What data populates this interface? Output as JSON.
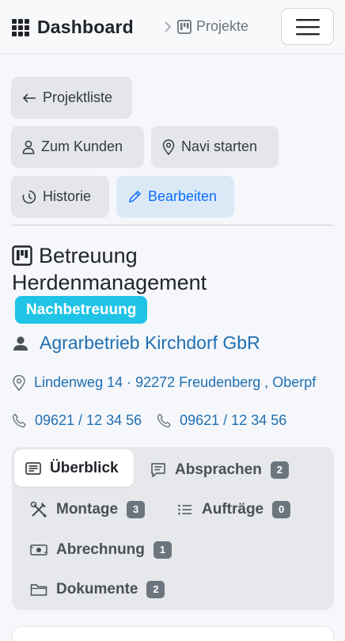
{
  "header": {
    "brand": "Dashboard",
    "breadcrumb": "Projekte"
  },
  "actions": {
    "back": "Projektliste",
    "customer": "Zum Kunden",
    "navigate": "Navi starten",
    "history": "Historie",
    "edit": "Bearbeiten"
  },
  "project": {
    "title": "Betreuung Herdenmanagement",
    "type_badge": "Nachbetreuung",
    "customer_name": "Agrarbetrieb Kirchdorf GbR",
    "address": "Lindenweg 14 · 92272 Freudenberg , Oberpf",
    "phones": [
      "09621 / 12 34 56",
      "09621 / 12 34 56"
    ]
  },
  "tabs": [
    {
      "label": "Überblick",
      "count": null,
      "active": true
    },
    {
      "label": "Absprachen",
      "count": "2",
      "active": false
    },
    {
      "label": "Montage",
      "count": "3",
      "active": false
    },
    {
      "label": "Aufträge",
      "count": "0",
      "active": false
    },
    {
      "label": "Abrechnung",
      "count": "1",
      "active": false
    },
    {
      "label": "Dokumente",
      "count": "2",
      "active": false
    }
  ],
  "colors": {
    "link": "#1f6fb2",
    "badge": "#1fc3e6",
    "primary": "#0d6efd"
  }
}
